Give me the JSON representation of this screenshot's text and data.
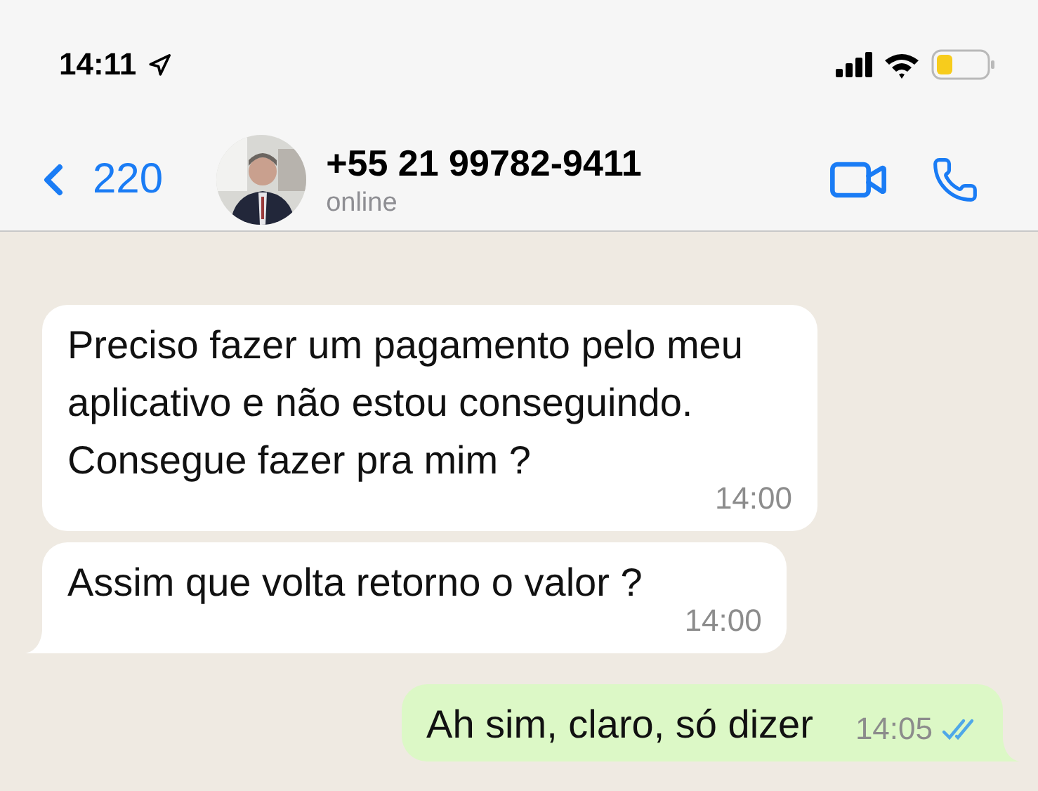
{
  "status_bar": {
    "time": "14:11"
  },
  "header": {
    "back_label": "220",
    "contact": {
      "name": "+55 21 99782-9411",
      "status": "online"
    }
  },
  "messages": [
    {
      "kind": "incoming",
      "text": "Preciso fazer um pagamento pelo meu aplicativo e não estou conseguindo. Consegue fazer pra mim ?",
      "time": "14:00",
      "tail": false
    },
    {
      "kind": "incoming",
      "text": "Assim que volta retorno o valor ?",
      "time": "14:00",
      "tail": true
    },
    {
      "kind": "outgoing",
      "text": "Ah sim, claro, só dizer",
      "time": "14:05",
      "tail": true,
      "read": true
    }
  ]
}
